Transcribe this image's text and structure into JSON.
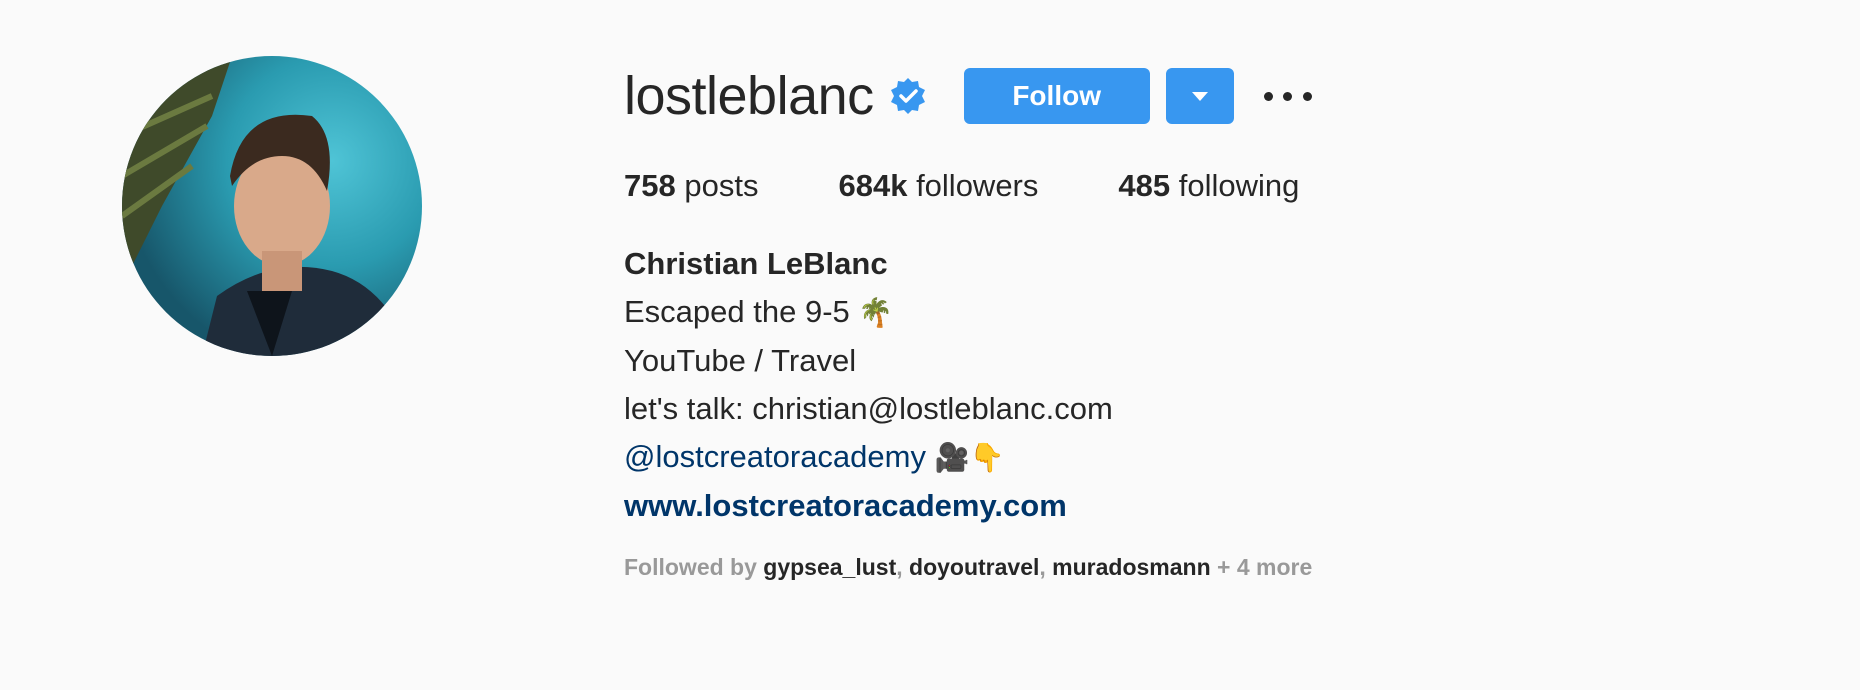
{
  "profile": {
    "username": "lostleblanc",
    "verified_icon": "verified-badge-icon",
    "follow_label": "Follow",
    "dropdown_icon": "caret-down-icon",
    "more_icon": "ellipsis-icon"
  },
  "stats": {
    "posts_count": "758",
    "posts_label": "posts",
    "followers_count": "684k",
    "followers_label": "followers",
    "following_count": "485",
    "following_label": "following"
  },
  "bio": {
    "full_name": "Christian LeBlanc",
    "line1": "Escaped the 9-5",
    "line1_emoji": "🌴",
    "line2": "YouTube / Travel",
    "line3": "let's talk: christian@lostleblanc.com",
    "mention": "@lostcreatoracademy",
    "mention_emoji": "🎥👇",
    "website": "www.lostcreatoracademy.com"
  },
  "followed_by": {
    "prefix": "Followed by",
    "users": [
      "gypsea_lust",
      "doyoutravel",
      "muradosmann"
    ],
    "sep": ",",
    "more": "+ 4 more"
  },
  "colors": {
    "accent": "#3897f0",
    "link": "#003569",
    "background": "#fafafa",
    "text": "#262626",
    "muted": "#999999"
  }
}
